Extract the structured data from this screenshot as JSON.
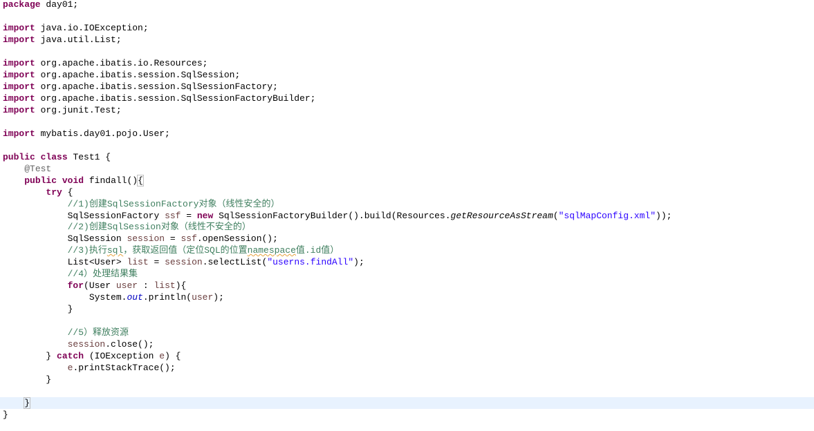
{
  "editor": {
    "language": "java",
    "colors": {
      "keyword": "#7f0055",
      "comment": "#3f7f5f",
      "string": "#2a00ff",
      "field": "#0000c0",
      "annotation": "#646464",
      "local_variable": "#6a3e3e",
      "current_line_highlight": "#e8f2fe"
    },
    "lines": {
      "package_kw": "package",
      "package_rest": " day01;",
      "import_kw": "import",
      "imp_ioexception": " java.io.IOException;",
      "imp_list": " java.util.List;",
      "imp_resources": " org.apache.ibatis.io.Resources;",
      "imp_sqlsession": " org.apache.ibatis.session.SqlSession;",
      "imp_sqlsessionfactory": " org.apache.ibatis.session.SqlSessionFactory;",
      "imp_sqlsessionfactorybuilder": " org.apache.ibatis.session.SqlSessionFactoryBuilder;",
      "imp_test": " org.junit.Test;",
      "imp_user": " mybatis.day01.pojo.User;",
      "public_kw": "public",
      "class_kw": "class",
      "class_rest": " Test1 {",
      "annotation": "@Test",
      "void_kw": "void",
      "method_name": " findall()",
      "open_brace": "{",
      "try_kw": "try",
      "try_rest": " {",
      "comment1": "//1)创建SqlSessionFactory对象（线性安全的）",
      "stmt1_type": "SqlSessionFactory ",
      "stmt1_var": "ssf",
      "stmt1_eq": " = ",
      "new_kw": "new",
      "stmt1_mid": " SqlSessionFactoryBuilder().build(Resources.",
      "stmt1_method": "getResourceAsStream",
      "stmt1_open": "(",
      "stmt1_string": "\"sqlMapConfig.xml\"",
      "stmt1_close": "));",
      "comment2": "//2)创建SqlSession对象（线性不安全的）",
      "stmt2_type": "SqlSession ",
      "stmt2_var": "session",
      "stmt2_eq": " = ",
      "stmt2_ref": "ssf",
      "stmt2_rest": ".openSession();",
      "comment3_a": "//3)执行",
      "comment3_b": "sql",
      "comment3_c": "，获取返回值（定位SQL的位置",
      "comment3_d": "namespace",
      "comment3_e": "值.id值）",
      "stmt3_type": "List<User> ",
      "stmt3_var": "list",
      "stmt3_eq": " = ",
      "stmt3_ref": "session",
      "stmt3_call": ".selectList(",
      "stmt3_string": "\"userns.findAll\"",
      "stmt3_end": ");",
      "comment4": "//4）处理结果集",
      "for_kw": "for",
      "for_open": "(User ",
      "for_var": "user",
      "for_colon": " : ",
      "for_list": "list",
      "for_close": "){",
      "println_a": "System.",
      "println_out": "out",
      "println_b": ".println(",
      "println_var": "user",
      "println_c": ");",
      "close_brace": "}",
      "comment5": "//5）释放资源",
      "close_ref": "session",
      "close_rest": ".close();",
      "catch_pre": "} ",
      "catch_kw": "catch",
      "catch_open": " (IOException ",
      "catch_var": "e",
      "catch_close": ") {",
      "print_ref": "e",
      "print_rest": ".printStackTrace();"
    }
  }
}
